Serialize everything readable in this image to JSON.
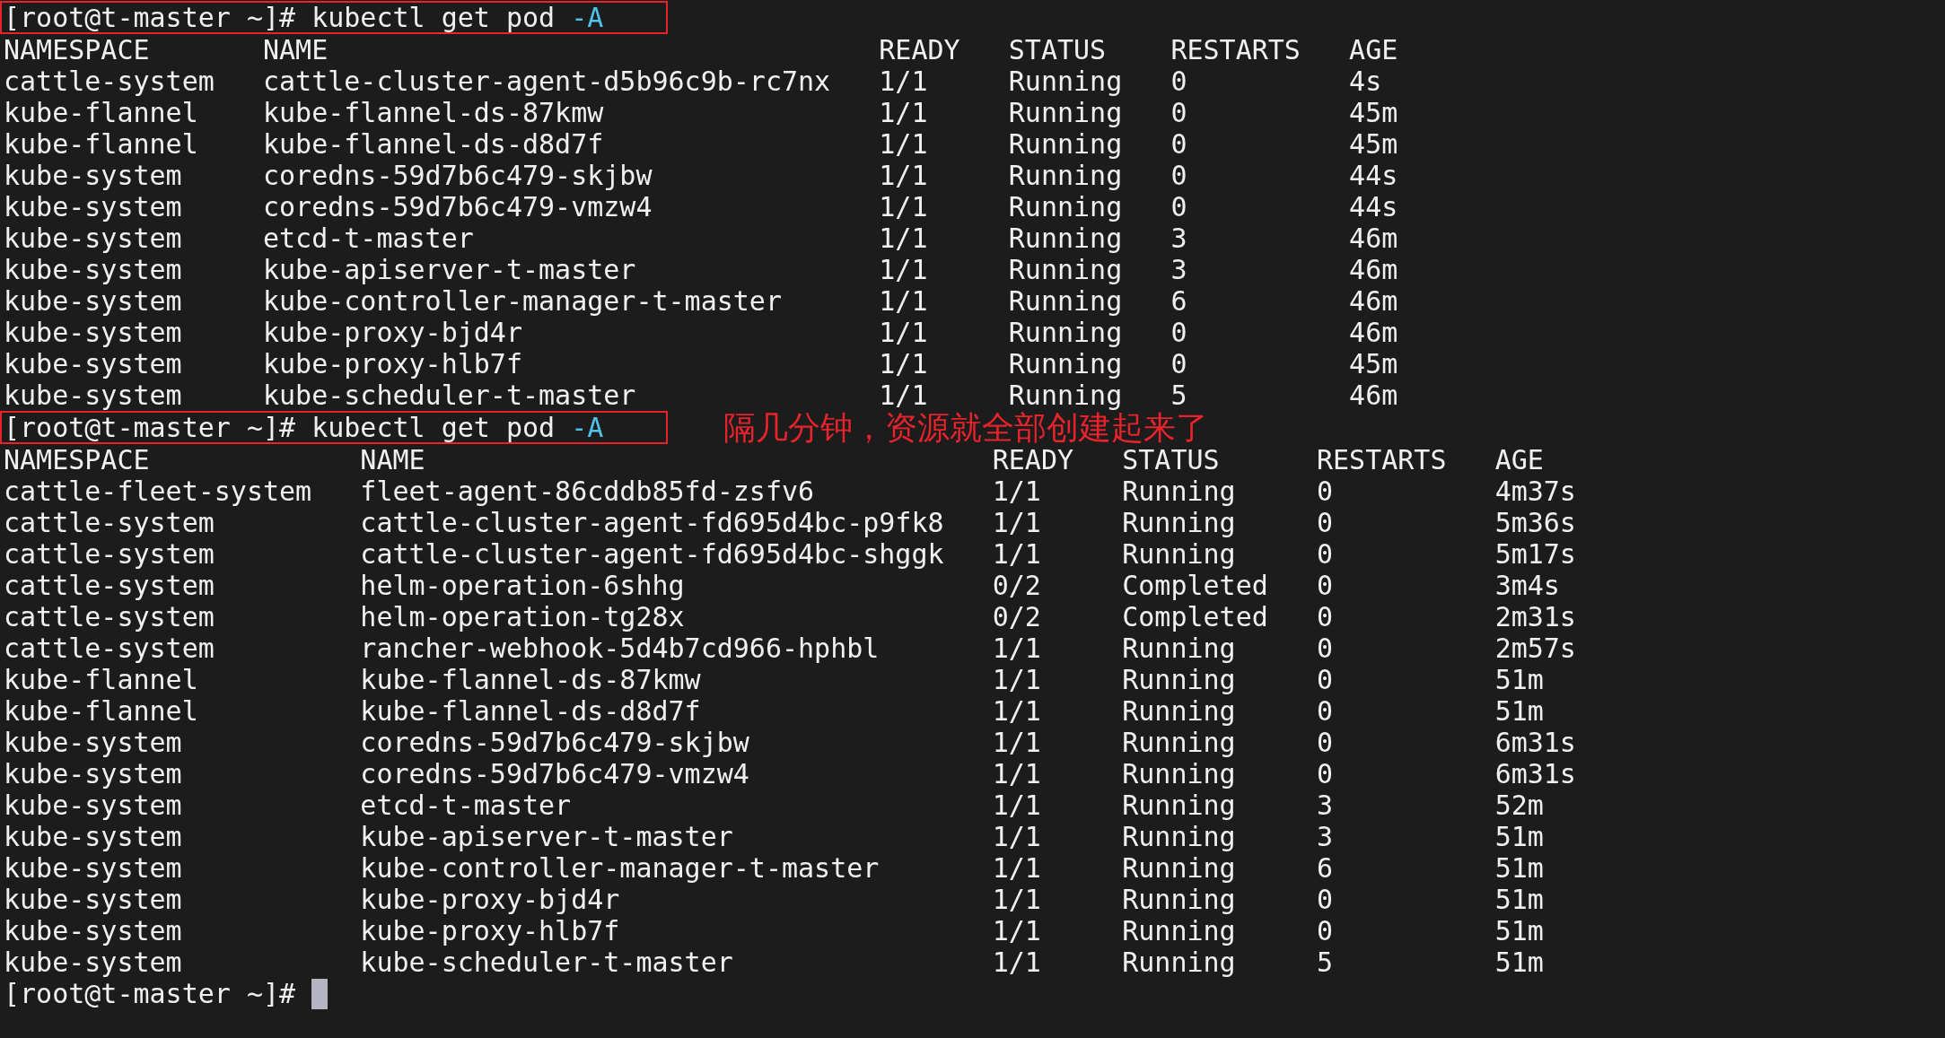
{
  "terminal": {
    "sections": [
      {
        "kind": "command",
        "prompt": "[root@t-master ~]#",
        "command": "kubectl get pod",
        "flag": "-A",
        "highlighted": true
      },
      {
        "kind": "table",
        "columns": [
          "NAMESPACE",
          "NAME",
          "READY",
          "STATUS",
          "RESTARTS",
          "AGE"
        ],
        "rows": [
          [
            "cattle-system",
            "cattle-cluster-agent-d5b96c9b-rc7nx",
            "1/1",
            "Running",
            "0",
            "4s"
          ],
          [
            "kube-flannel",
            "kube-flannel-ds-87kmw",
            "1/1",
            "Running",
            "0",
            "45m"
          ],
          [
            "kube-flannel",
            "kube-flannel-ds-d8d7f",
            "1/1",
            "Running",
            "0",
            "45m"
          ],
          [
            "kube-system",
            "coredns-59d7b6c479-skjbw",
            "1/1",
            "Running",
            "0",
            "44s"
          ],
          [
            "kube-system",
            "coredns-59d7b6c479-vmzw4",
            "1/1",
            "Running",
            "0",
            "44s"
          ],
          [
            "kube-system",
            "etcd-t-master",
            "1/1",
            "Running",
            "3",
            "46m"
          ],
          [
            "kube-system",
            "kube-apiserver-t-master",
            "1/1",
            "Running",
            "3",
            "46m"
          ],
          [
            "kube-system",
            "kube-controller-manager-t-master",
            "1/1",
            "Running",
            "6",
            "46m"
          ],
          [
            "kube-system",
            "kube-proxy-bjd4r",
            "1/1",
            "Running",
            "0",
            "46m"
          ],
          [
            "kube-system",
            "kube-proxy-hlb7f",
            "1/1",
            "Running",
            "0",
            "45m"
          ],
          [
            "kube-system",
            "kube-scheduler-t-master",
            "1/1",
            "Running",
            "5",
            "46m"
          ]
        ]
      },
      {
        "kind": "command",
        "prompt": "[root@t-master ~]#",
        "command": "kubectl get pod",
        "flag": "-A",
        "highlighted": true,
        "annotation": "隔几分钟，资源就全部创建起来了"
      },
      {
        "kind": "table",
        "columns": [
          "NAMESPACE",
          "NAME",
          "READY",
          "STATUS",
          "RESTARTS",
          "AGE"
        ],
        "rows": [
          [
            "cattle-fleet-system",
            "fleet-agent-86cddb85fd-zsfv6",
            "1/1",
            "Running",
            "0",
            "4m37s"
          ],
          [
            "cattle-system",
            "cattle-cluster-agent-fd695d4bc-p9fk8",
            "1/1",
            "Running",
            "0",
            "5m36s"
          ],
          [
            "cattle-system",
            "cattle-cluster-agent-fd695d4bc-shggk",
            "1/1",
            "Running",
            "0",
            "5m17s"
          ],
          [
            "cattle-system",
            "helm-operation-6shhg",
            "0/2",
            "Completed",
            "0",
            "3m4s"
          ],
          [
            "cattle-system",
            "helm-operation-tg28x",
            "0/2",
            "Completed",
            "0",
            "2m31s"
          ],
          [
            "cattle-system",
            "rancher-webhook-5d4b7cd966-hphbl",
            "1/1",
            "Running",
            "0",
            "2m57s"
          ],
          [
            "kube-flannel",
            "kube-flannel-ds-87kmw",
            "1/1",
            "Running",
            "0",
            "51m"
          ],
          [
            "kube-flannel",
            "kube-flannel-ds-d8d7f",
            "1/1",
            "Running",
            "0",
            "51m"
          ],
          [
            "kube-system",
            "coredns-59d7b6c479-skjbw",
            "1/1",
            "Running",
            "0",
            "6m31s"
          ],
          [
            "kube-system",
            "coredns-59d7b6c479-vmzw4",
            "1/1",
            "Running",
            "0",
            "6m31s"
          ],
          [
            "kube-system",
            "etcd-t-master",
            "1/1",
            "Running",
            "3",
            "52m"
          ],
          [
            "kube-system",
            "kube-apiserver-t-master",
            "1/1",
            "Running",
            "3",
            "51m"
          ],
          [
            "kube-system",
            "kube-controller-manager-t-master",
            "1/1",
            "Running",
            "6",
            "51m"
          ],
          [
            "kube-system",
            "kube-proxy-bjd4r",
            "1/1",
            "Running",
            "0",
            "51m"
          ],
          [
            "kube-system",
            "kube-proxy-hlb7f",
            "1/1",
            "Running",
            "0",
            "51m"
          ],
          [
            "kube-system",
            "kube-scheduler-t-master",
            "1/1",
            "Running",
            "5",
            "51m"
          ]
        ]
      },
      {
        "kind": "prompt",
        "prompt": "[root@t-master ~]#",
        "cursor": true
      }
    ]
  }
}
